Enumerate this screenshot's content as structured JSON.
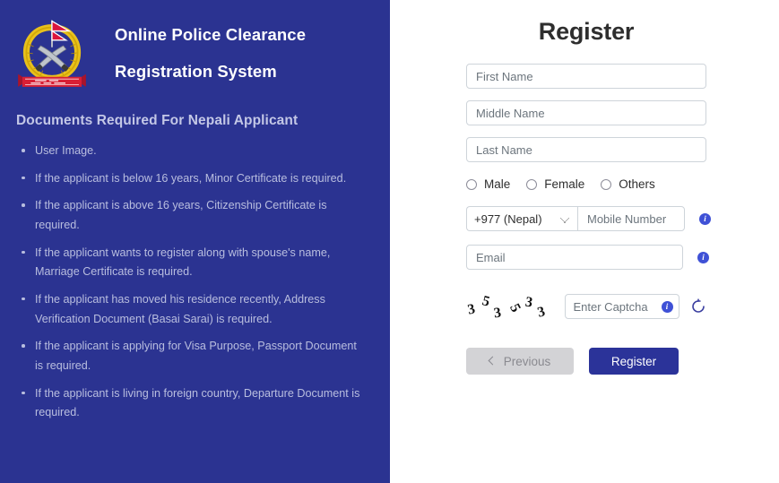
{
  "sidebar": {
    "logo_name": "nepal-police-emblem",
    "title_line1": "Online Police Clearance",
    "title_line2": "Registration System",
    "docs_heading": "Documents Required For Nepali Applicant",
    "docs": [
      "User Image.",
      "If the applicant is below 16 years, Minor Certificate is required.",
      "If the applicant is above 16 years, Citizenship Certificate is required.",
      "If the applicant wants to register along with spouse's name, Marriage Certificate is required.",
      "If the applicant has moved his residence recently, Address Verification Document (Basai Sarai) is required.",
      "If the applicant is applying for Visa Purpose, Passport Document is required.",
      "If the applicant is living in foreign country, Departure Document is required."
    ],
    "background_color": "#2b3391",
    "heading_color": "#c3c7e6",
    "text_color": "#b9bedf"
  },
  "form": {
    "title": "Register",
    "first_name": {
      "value": "",
      "placeholder": "First Name"
    },
    "middle_name": {
      "value": "",
      "placeholder": "Middle Name"
    },
    "last_name": {
      "value": "",
      "placeholder": "Last Name"
    },
    "gender": {
      "options": [
        {
          "label": "Male",
          "selected": false
        },
        {
          "label": "Female",
          "selected": false
        },
        {
          "label": "Others",
          "selected": false
        }
      ]
    },
    "country_code": {
      "selected": "+977 (Nepal)",
      "options": [
        "+977 (Nepal)"
      ]
    },
    "mobile": {
      "value": "",
      "placeholder": "Mobile Number"
    },
    "email": {
      "value": "",
      "placeholder": "Email"
    },
    "captcha": {
      "image_characters": [
        "3",
        "5",
        "3",
        "5",
        "3",
        "3"
      ],
      "input": {
        "value": "",
        "placeholder": "Enter Captcha"
      },
      "refresh_icon": "refresh-icon",
      "info_icon": "info-icon"
    },
    "buttons": {
      "previous": "Previous",
      "register": "Register"
    },
    "accent_color": "#2b3399",
    "info_icon_color": "#3f51d6"
  }
}
